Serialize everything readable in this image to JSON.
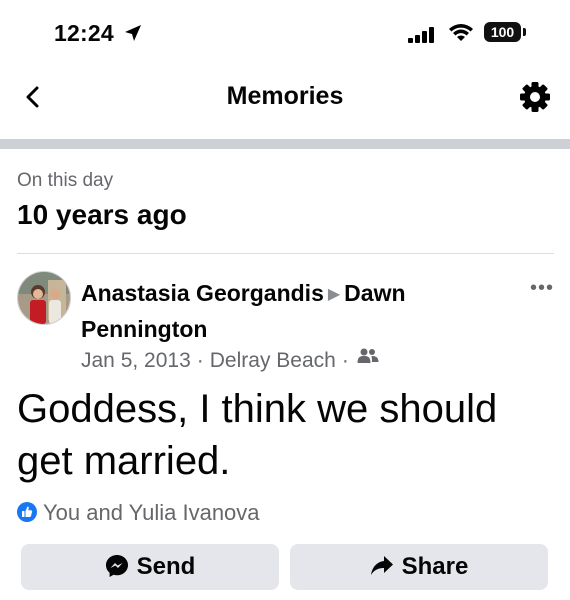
{
  "status_bar": {
    "time": "12:24",
    "battery": "100"
  },
  "nav": {
    "title": "Memories"
  },
  "memory": {
    "subtitle": "On this day",
    "title": "10 years ago"
  },
  "post": {
    "author": "Anastasia Georgandis",
    "target": "Dawn Pennington",
    "date": "Jan 5, 2013",
    "location": "Delray Beach",
    "audience_icon": "friends-icon",
    "text": "Goddess, I think we should get married.",
    "reactions": "You and Yulia Ivanova"
  },
  "actions": {
    "send_label": "Send",
    "share_label": "Share"
  },
  "colors": {
    "secondary_text": "#65676b",
    "button_bg": "#e4e6eb",
    "like_blue": "#1877f2"
  }
}
